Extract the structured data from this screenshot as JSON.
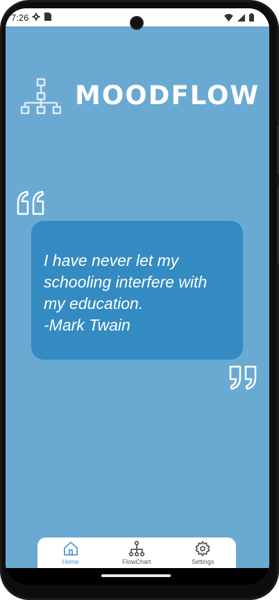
{
  "status_bar": {
    "time": "7:26",
    "left_icons": [
      "gear-icon",
      "sim-card-icon"
    ],
    "right_icons": [
      "wifi-icon",
      "signal-icon",
      "battery-icon"
    ]
  },
  "brand": {
    "name": "MOODFLOW",
    "icon": "hierarchy-icon"
  },
  "quote": {
    "text": "I have never let my schooling interfere with my education.",
    "author": "-Mark Twain"
  },
  "nav": {
    "items": [
      {
        "label": "Home",
        "icon": "home-icon",
        "active": true
      },
      {
        "label": "FlowChart",
        "icon": "flowchart-icon",
        "active": false
      },
      {
        "label": "Settings",
        "icon": "gear-icon",
        "active": false
      }
    ]
  },
  "colors": {
    "background": "#6aaad2",
    "card": "#338bc2",
    "accent": "#4b97cf",
    "white": "#ffffff"
  }
}
